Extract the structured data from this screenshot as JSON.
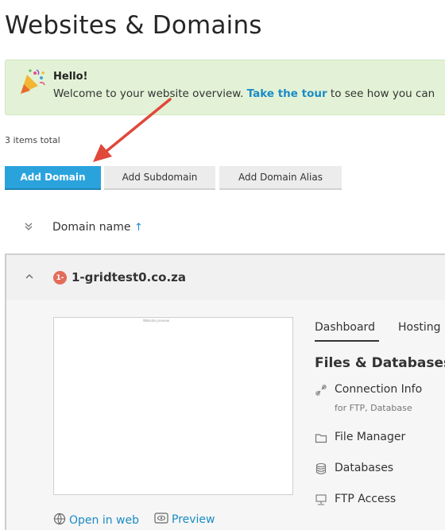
{
  "page": {
    "title": "Websites & Domains"
  },
  "banner": {
    "hello": "Hello!",
    "text_before": "Welcome to your website overview. ",
    "link": "Take the tour",
    "text_after": " to see how you can"
  },
  "list": {
    "items_total": "3 items total",
    "buttons": {
      "add_domain": "Add Domain",
      "add_subdomain": "Add Subdomain",
      "add_domain_alias": "Add Domain Alias"
    },
    "column_header": {
      "label": "Domain name",
      "sort_arrow": "↑"
    }
  },
  "domain": {
    "name": "1-gridtest0.co.za",
    "badge": "1-",
    "thumbnail_caption": "Website preview",
    "open_in_web": "Open in web",
    "preview": "Preview",
    "tabs": [
      "Dashboard",
      "Hosting"
    ],
    "section_title": "Files & Databases",
    "tools": [
      {
        "label": "Connection Info",
        "sub": "for FTP, Database",
        "icon": "connection-icon"
      },
      {
        "label": "File Manager",
        "icon": "folder-icon"
      },
      {
        "label": "Databases",
        "icon": "database-icon"
      },
      {
        "label": "FTP Access",
        "icon": "ftp-icon"
      }
    ]
  },
  "colors": {
    "primary": "#2aa3dd",
    "link": "#1b8bc5",
    "banner_bg": "#e3f2d6",
    "annotation_arrow": "#e0483a"
  }
}
